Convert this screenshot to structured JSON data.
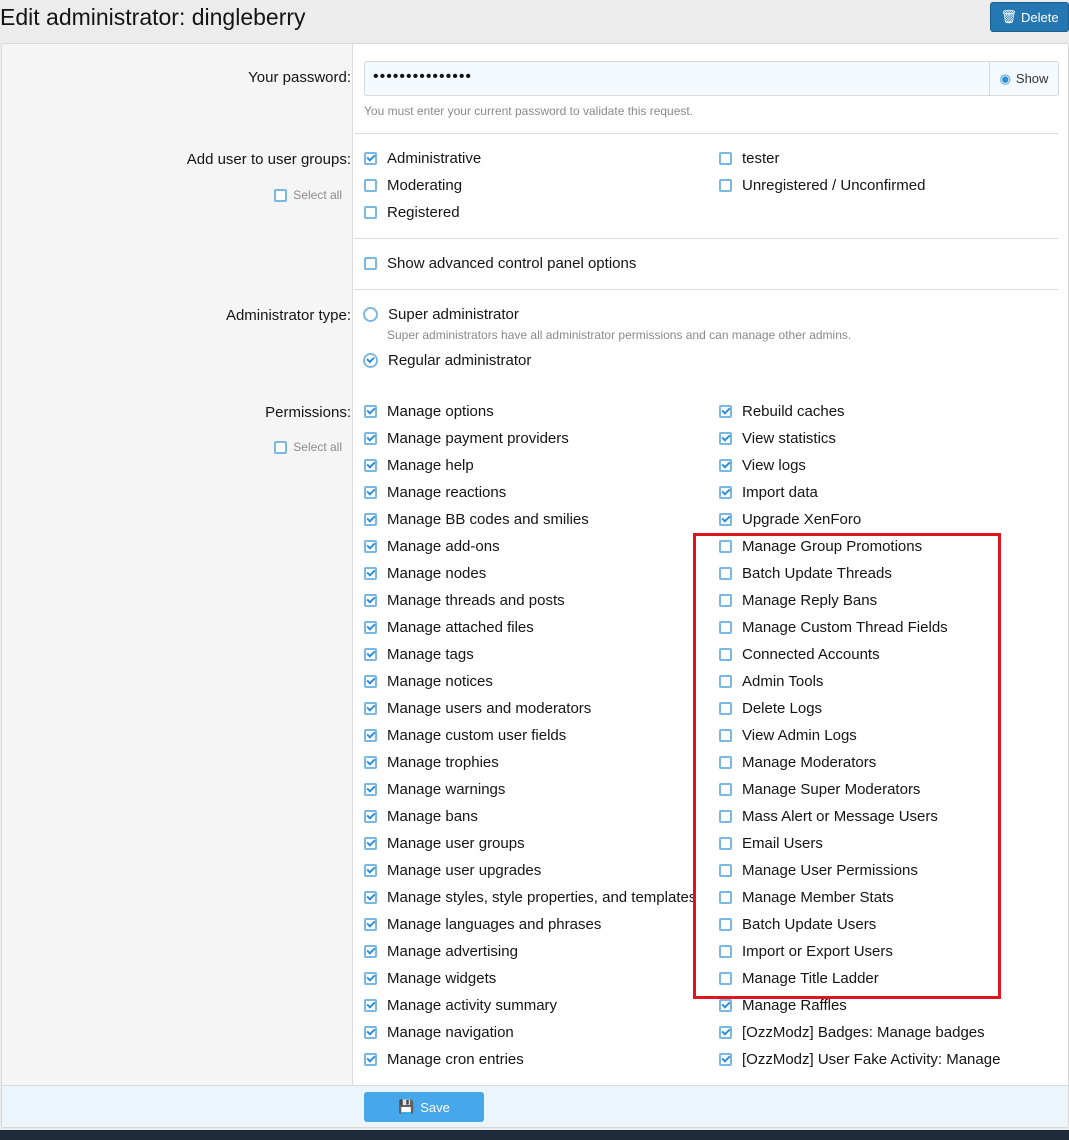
{
  "page_title": "Edit administrator: dingleberry",
  "delete_label": "Delete",
  "password": {
    "label": "Your password:",
    "value": "•••••••••••••••",
    "show_label": "Show",
    "hint": "You must enter your current password to validate this request."
  },
  "user_groups": {
    "label": "Add user to user groups:",
    "select_all": "Select all",
    "items": [
      {
        "label": "Administrative",
        "checked": true
      },
      {
        "label": "Moderating",
        "checked": false
      },
      {
        "label": "Registered",
        "checked": false
      },
      {
        "label": "tester",
        "checked": false
      },
      {
        "label": "Unregistered / Unconfirmed",
        "checked": false
      }
    ]
  },
  "advanced": {
    "label": "Show advanced control panel options",
    "checked": false
  },
  "admin_type": {
    "label": "Administrator type:",
    "options": [
      {
        "label": "Super administrator",
        "hint": "Super administrators have all administrator permissions and can manage other admins.",
        "selected": false
      },
      {
        "label": "Regular administrator",
        "selected": true
      }
    ]
  },
  "permissions": {
    "label": "Permissions:",
    "select_all": "Select all",
    "left": [
      {
        "label": "Manage options",
        "checked": true
      },
      {
        "label": "Manage payment providers",
        "checked": true
      },
      {
        "label": "Manage help",
        "checked": true
      },
      {
        "label": "Manage reactions",
        "checked": true
      },
      {
        "label": "Manage BB codes and smilies",
        "checked": true
      },
      {
        "label": "Manage add-ons",
        "checked": true
      },
      {
        "label": "Manage nodes",
        "checked": true
      },
      {
        "label": "Manage threads and posts",
        "checked": true
      },
      {
        "label": "Manage attached files",
        "checked": true
      },
      {
        "label": "Manage tags",
        "checked": true
      },
      {
        "label": "Manage notices",
        "checked": true
      },
      {
        "label": "Manage users and moderators",
        "checked": true
      },
      {
        "label": "Manage custom user fields",
        "checked": true
      },
      {
        "label": "Manage trophies",
        "checked": true
      },
      {
        "label": "Manage warnings",
        "checked": true
      },
      {
        "label": "Manage bans",
        "checked": true
      },
      {
        "label": "Manage user groups",
        "checked": true
      },
      {
        "label": "Manage user upgrades",
        "checked": true
      },
      {
        "label": "Manage styles, style properties, and templates",
        "checked": true
      },
      {
        "label": "Manage languages and phrases",
        "checked": true
      },
      {
        "label": "Manage advertising",
        "checked": true
      },
      {
        "label": "Manage widgets",
        "checked": true
      },
      {
        "label": "Manage activity summary",
        "checked": true
      },
      {
        "label": "Manage navigation",
        "checked": true
      },
      {
        "label": "Manage cron entries",
        "checked": true
      }
    ],
    "right": [
      {
        "label": "Rebuild caches",
        "checked": true
      },
      {
        "label": "View statistics",
        "checked": true
      },
      {
        "label": "View logs",
        "checked": true
      },
      {
        "label": "Import data",
        "checked": true
      },
      {
        "label": "Upgrade XenForo",
        "checked": true
      },
      {
        "label": "Manage Group Promotions",
        "checked": false
      },
      {
        "label": "Batch Update Threads",
        "checked": false
      },
      {
        "label": "Manage Reply Bans",
        "checked": false
      },
      {
        "label": "Manage Custom Thread Fields",
        "checked": false
      },
      {
        "label": "Connected Accounts",
        "checked": false
      },
      {
        "label": "Admin Tools",
        "checked": false
      },
      {
        "label": "Delete Logs",
        "checked": false
      },
      {
        "label": "View Admin Logs",
        "checked": false
      },
      {
        "label": "Manage Moderators",
        "checked": false
      },
      {
        "label": "Manage Super Moderators",
        "checked": false
      },
      {
        "label": "Mass Alert or Message Users",
        "checked": false
      },
      {
        "label": "Email Users",
        "checked": false
      },
      {
        "label": "Manage User Permissions",
        "checked": false
      },
      {
        "label": "Manage Member Stats",
        "checked": false
      },
      {
        "label": "Batch Update Users",
        "checked": false
      },
      {
        "label": "Import or Export Users",
        "checked": false
      },
      {
        "label": "Manage Title Ladder",
        "checked": false
      },
      {
        "label": "Manage Raffles",
        "checked": true
      },
      {
        "label": "[OzzModz] Badges: Manage badges",
        "checked": true
      },
      {
        "label": "[OzzModz] User Fake Activity: Manage",
        "checked": true
      }
    ]
  },
  "save_label": "Save",
  "annotation_color": "#e0161f"
}
